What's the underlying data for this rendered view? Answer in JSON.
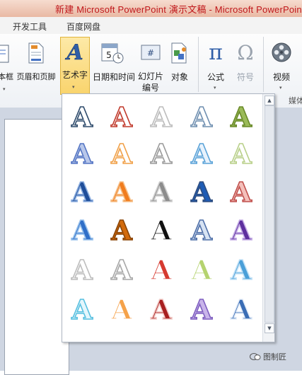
{
  "window_title": "新建 Microsoft PowerPoint 演示文稿 - Microsoft PowerPoint",
  "tabs": [
    "开发工具",
    "百度网盘"
  ],
  "ribbon": {
    "textbox_label": "本框",
    "header_footer_label": "页眉和页脚",
    "wordart_label": "艺术字",
    "datetime_label": "日期和时间",
    "slide_number_label": "幻灯片编号",
    "object_label": "对象",
    "equation_label": "公式",
    "symbol_label": "符号",
    "video_label": "视频",
    "media_group_label": "媒体"
  },
  "wordart": {
    "glyph": "A",
    "styles": [
      [
        "#ffffff",
        "#2d4a6b"
      ],
      [
        "#ffffff",
        "#c0392b"
      ],
      [
        "#ffffff",
        "#bcbcbc"
      ],
      [
        "#ffffff",
        "#6f8fb0"
      ],
      [
        "#9bbb59",
        "#6a8a2a"
      ],
      [
        "#b8c7ea",
        "#5576c4"
      ],
      [
        "#ffffff",
        "#f0a048"
      ],
      [
        "#ffffff",
        "#9a9a9a"
      ],
      [
        "#e8f2fc",
        "#5ba3d8"
      ],
      [
        "#ffffff",
        "#b9d08a"
      ],
      [
        "#1f4e9a",
        "#8fb0e0"
      ],
      [
        "#f07c1e",
        "#f6c08a"
      ],
      [
        "#8c8c8c",
        "#d0d0d0"
      ],
      [
        "#1e5cb5",
        "#2f4e80"
      ],
      [
        "#f4c0bb",
        "#c0504d"
      ],
      [
        "#2f6fc8",
        "#9ac2ec"
      ],
      [
        "#d26a0c",
        "#8a4507"
      ],
      [
        "#111111",
        "#ffffff"
      ],
      [
        "#d7e3f3",
        "#4f6fa8"
      ],
      [
        "#5d2f9e",
        "#c7b0e6"
      ],
      [
        "#ffffff",
        "#bdbdbd"
      ],
      [
        "#ffffff",
        "#a7a7a7"
      ],
      [
        "#d63a30",
        "#ffffff"
      ],
      [
        "#b5d36f",
        "#ffffff"
      ],
      [
        "#4a9fd8",
        "#c6e3f7"
      ],
      [
        "#e4f6fc",
        "#58c0e0"
      ],
      [
        "#f5a24a",
        "#ffffff"
      ],
      [
        "#a81f1f",
        "#f3d0cc"
      ],
      [
        "#c9b5ea",
        "#7f5fc0"
      ],
      [
        "#3a6db5",
        "#e6eef9"
      ]
    ]
  },
  "scrollbar": {
    "up_icon": "▲",
    "down_icon": "▼"
  },
  "watermark": "图制匠"
}
